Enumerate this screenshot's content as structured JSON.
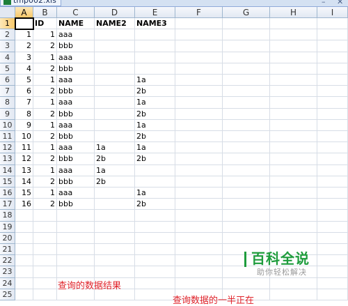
{
  "window": {
    "tab_name": "tmp002.xls",
    "minimize": "–",
    "close": "✕"
  },
  "sheet": {
    "columns": [
      "A",
      "B",
      "C",
      "D",
      "E",
      "F",
      "G",
      "H",
      "I"
    ],
    "rows": [
      [
        "",
        "ID",
        "NAME",
        "NAME2",
        "NAME3"
      ],
      [
        "1",
        "1",
        "aaa",
        "",
        ""
      ],
      [
        "2",
        "2",
        "bbb",
        "",
        ""
      ],
      [
        "3",
        "1",
        "aaa",
        "",
        ""
      ],
      [
        "4",
        "2",
        "bbb",
        "",
        ""
      ],
      [
        "5",
        "1",
        "aaa",
        "",
        "1a"
      ],
      [
        "6",
        "2",
        "bbb",
        "",
        "2b"
      ],
      [
        "7",
        "1",
        "aaa",
        "",
        "1a"
      ],
      [
        "8",
        "2",
        "bbb",
        "",
        "2b"
      ],
      [
        "9",
        "1",
        "aaa",
        "",
        "1a"
      ],
      [
        "10",
        "2",
        "bbb",
        "",
        "2b"
      ],
      [
        "11",
        "1",
        "aaa",
        "1a",
        "1a"
      ],
      [
        "12",
        "2",
        "bbb",
        "2b",
        "2b"
      ],
      [
        "13",
        "1",
        "aaa",
        "1a",
        ""
      ],
      [
        "14",
        "2",
        "bbb",
        "2b",
        ""
      ],
      [
        "15",
        "1",
        "aaa",
        "",
        "1a"
      ],
      [
        "16",
        "2",
        "bbb",
        "",
        "2b"
      ],
      [
        "",
        "",
        "",
        "",
        ""
      ],
      [
        "",
        "",
        "",
        "",
        ""
      ],
      [
        "",
        "",
        "",
        "",
        ""
      ],
      [
        "",
        "",
        "",
        "",
        ""
      ],
      [
        "",
        "",
        "",
        "",
        ""
      ],
      [
        "",
        "",
        "",
        "",
        ""
      ],
      [
        "",
        "",
        "",
        "",
        ""
      ],
      [
        "",
        "",
        "",
        "",
        ""
      ]
    ],
    "selected_cell": "A1"
  },
  "annotations": {
    "result_label": "查询的数据结果",
    "partial_label": "查询数据的一半正在"
  },
  "watermark": {
    "title": "百科全说",
    "subtitle": "助你轻松解决"
  },
  "colors": {
    "annotation": "#e0232a",
    "watermark": "#1e9c3c"
  }
}
